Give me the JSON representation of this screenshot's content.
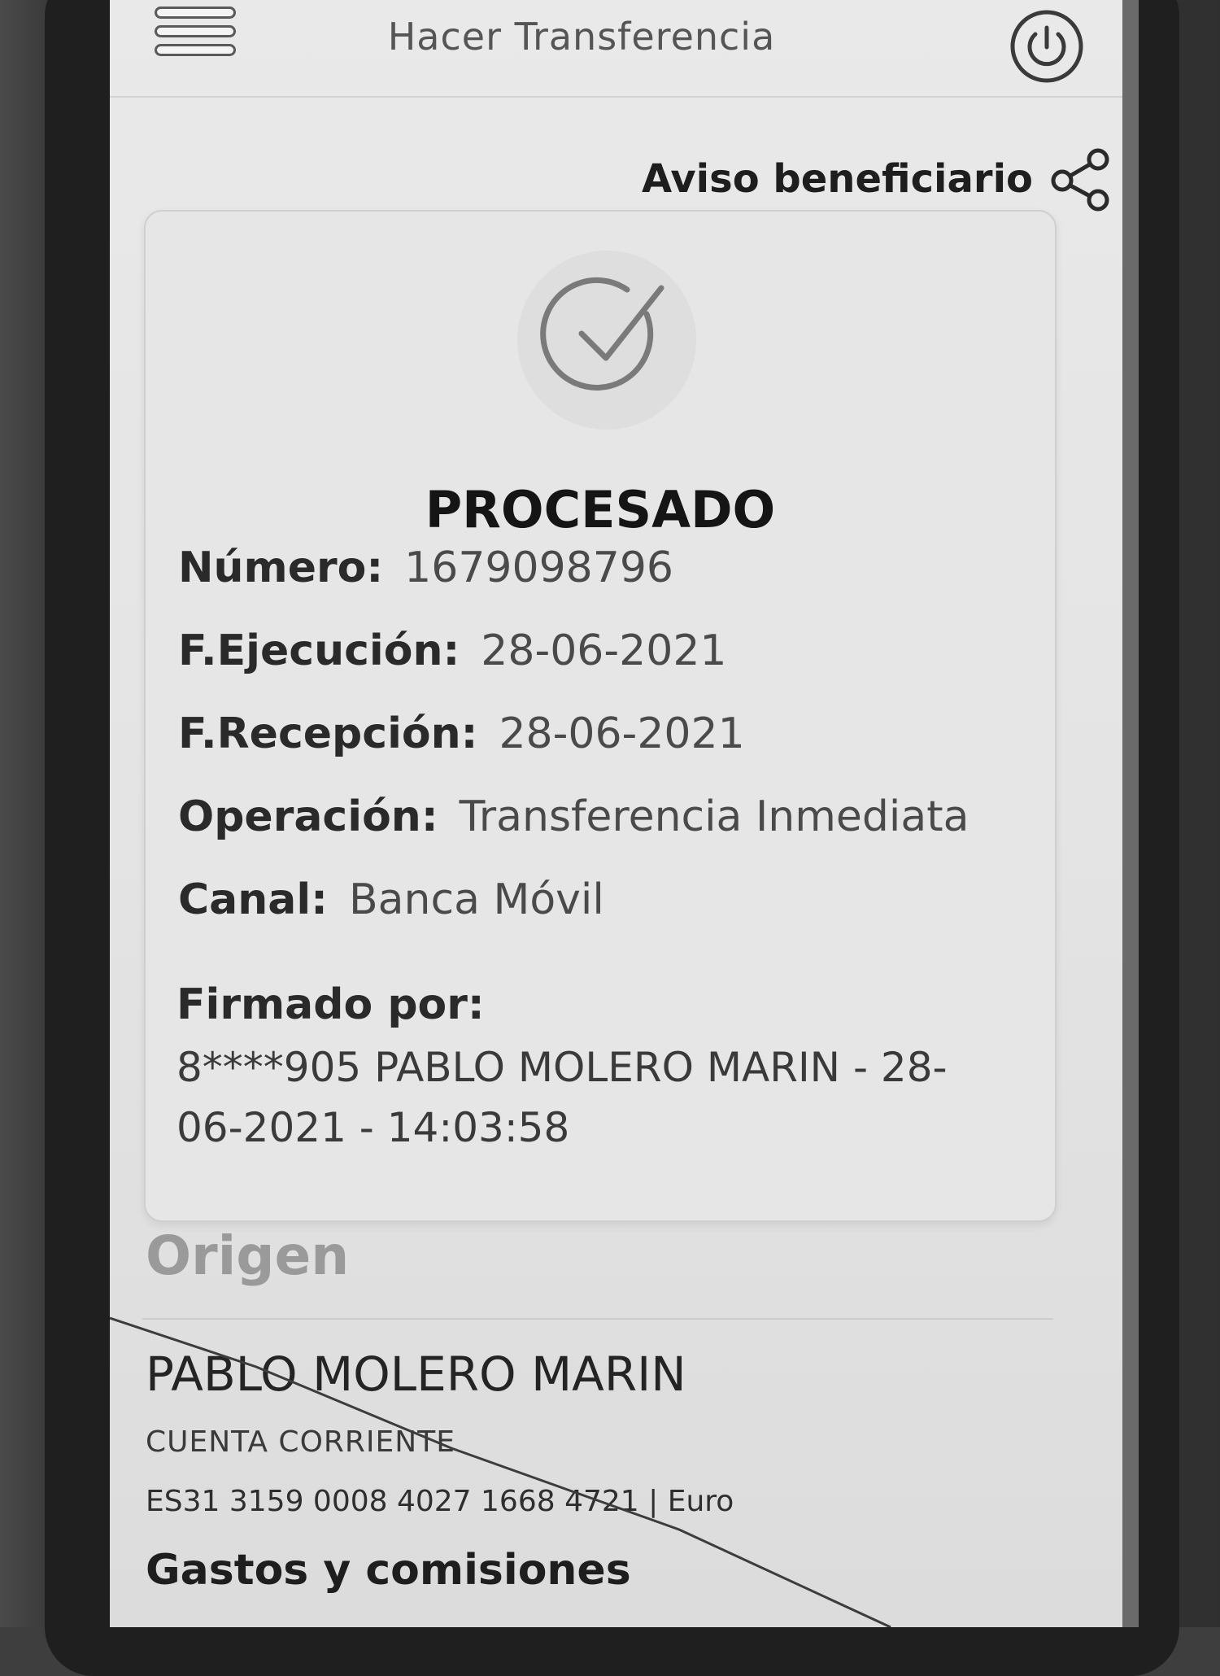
{
  "header": {
    "title": "Hacer Transferencia",
    "menu_icon": "hamburger-menu-icon",
    "power_icon": "power-icon"
  },
  "share": {
    "label": "Aviso beneficiario",
    "icon": "share-icon"
  },
  "receipt": {
    "status_icon": "check-circle-icon",
    "status": "PROCESADO",
    "fields": [
      {
        "label": "Número:",
        "value": "1679098796"
      },
      {
        "label": "F.Ejecución:",
        "value": "28-06-2021"
      },
      {
        "label": "F.Recepción:",
        "value": "28-06-2021"
      },
      {
        "label": "Operación:",
        "value": "Transferencia Inmediata"
      },
      {
        "label": "Canal:",
        "value": "Banca Móvil"
      }
    ],
    "signed_label": "Firmado por:",
    "signed_value": "8****905   PABLO MOLERO MARIN - 28-06-2021 - 14:03:58"
  },
  "origin": {
    "title": "Origen",
    "holder": "PABLO MOLERO MARIN",
    "account_type": "CUENTA CORRIENTE",
    "iban": "ES31 3159 0008 4027 1668 4721 | Euro"
  },
  "fees": {
    "title": "Gastos y comisiones"
  }
}
